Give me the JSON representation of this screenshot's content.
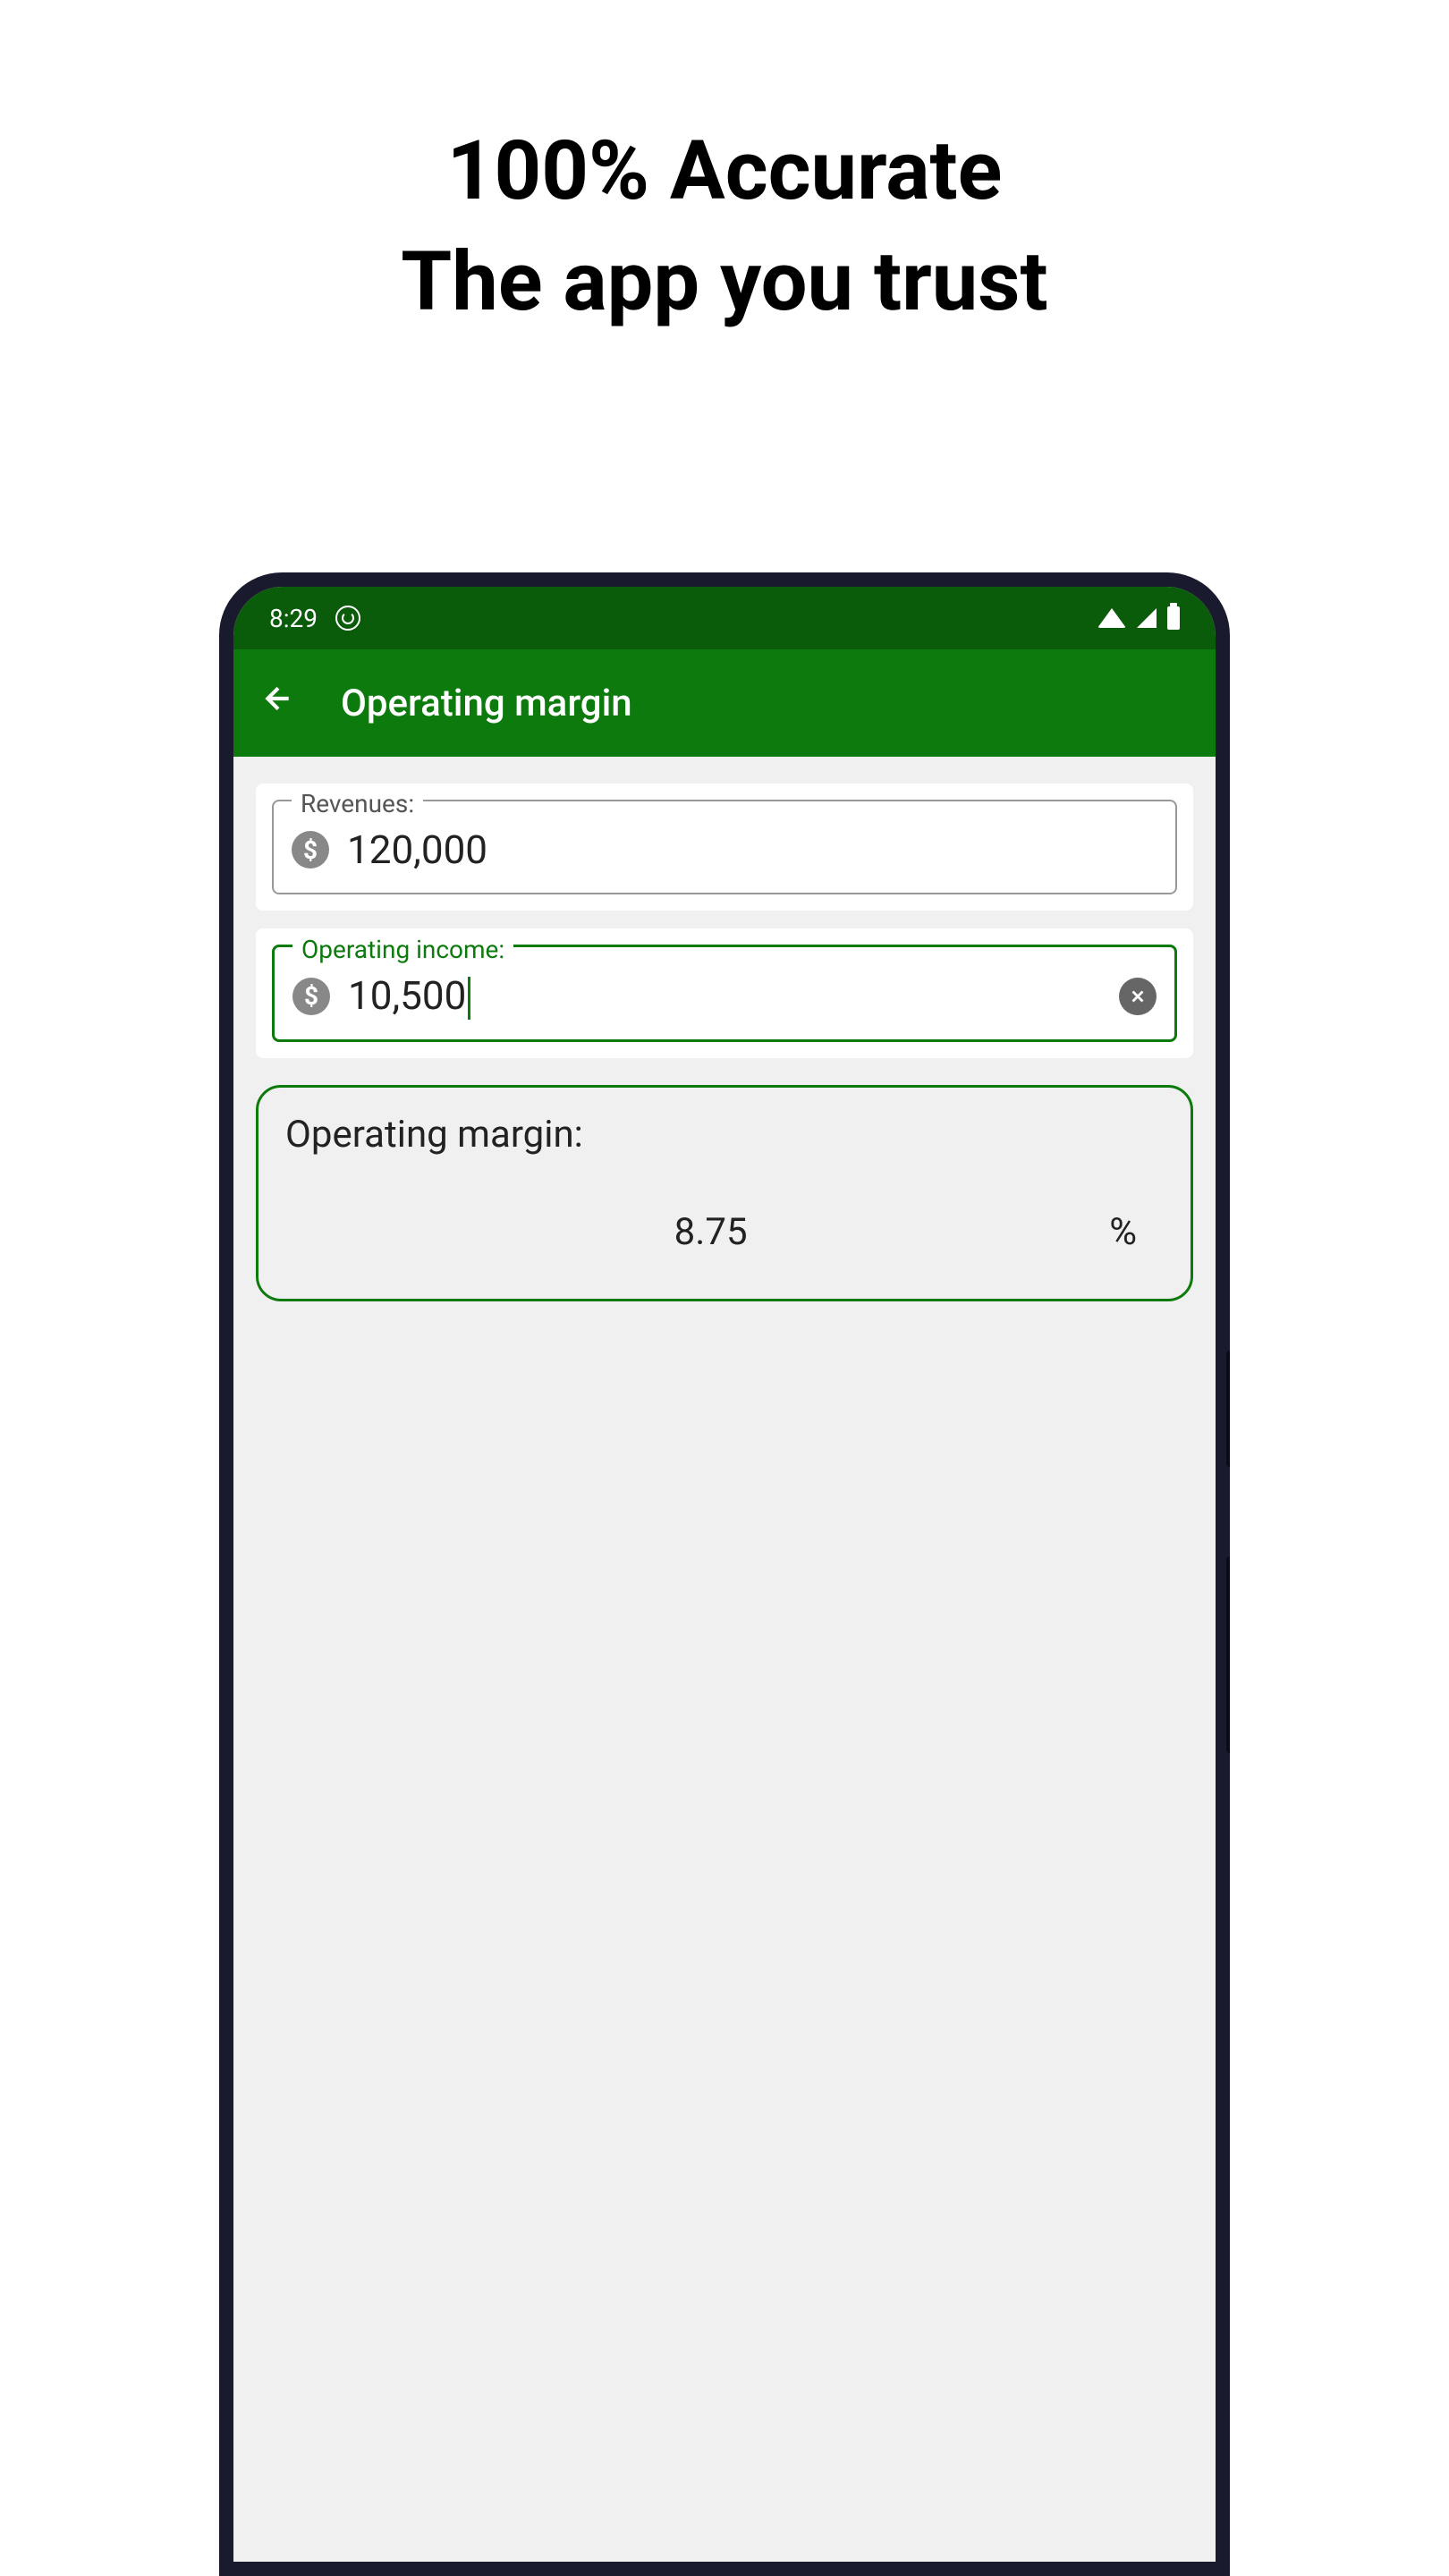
{
  "promo": {
    "line1": "100% Accurate",
    "line2": "The app you trust"
  },
  "statusBar": {
    "time": "8:29"
  },
  "appBar": {
    "title": "Operating margin"
  },
  "inputs": {
    "revenues": {
      "label": "Revenues:",
      "value": "120,000"
    },
    "operatingIncome": {
      "label": "Operating income:",
      "value": "10,500"
    }
  },
  "result": {
    "label": "Operating margin:",
    "value": "8.75",
    "unit": "%"
  }
}
